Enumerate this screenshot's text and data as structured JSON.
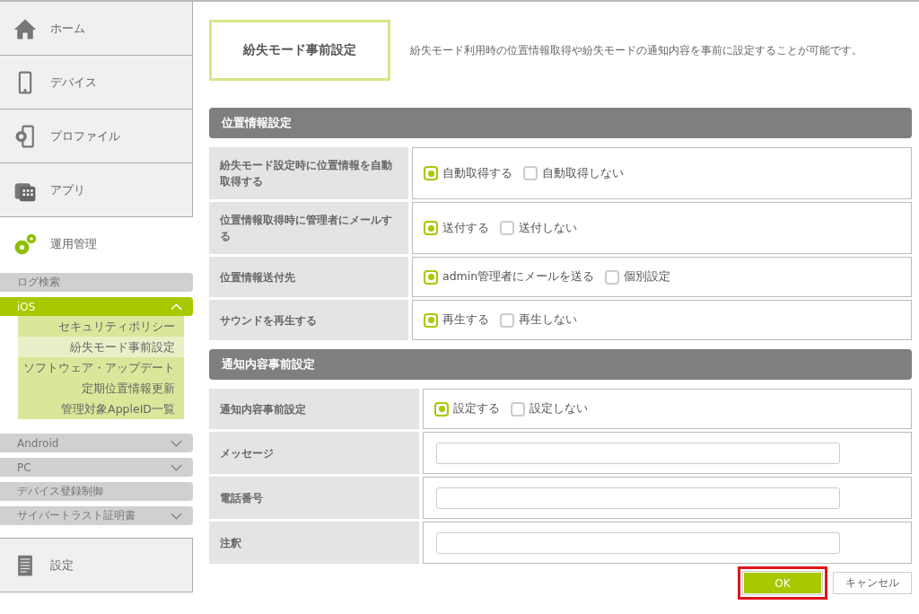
{
  "sidebar": {
    "items": [
      {
        "label": "ホーム",
        "selected": false
      },
      {
        "label": "デバイス",
        "selected": false
      },
      {
        "label": "プロファイル",
        "selected": false
      },
      {
        "label": "アプリ",
        "selected": false
      },
      {
        "label": "運用管理",
        "selected": true
      }
    ],
    "submenu": [
      {
        "kind": "link",
        "label": "ログ検索"
      },
      {
        "kind": "group",
        "label": "iOS",
        "expanded": true,
        "children": [
          {
            "label": "セキュリティポリシー",
            "selected": false
          },
          {
            "label": "紛失モード事前設定",
            "selected": true
          },
          {
            "label": "ソフトウェア・アップデート",
            "selected": false
          },
          {
            "label": "定期位置情報更新",
            "selected": false
          },
          {
            "label": "管理対象AppleID一覧",
            "selected": false
          }
        ]
      },
      {
        "kind": "group",
        "label": "Android",
        "expanded": false
      },
      {
        "kind": "group",
        "label": "PC",
        "expanded": false
      },
      {
        "kind": "link",
        "label": "デバイス登録制御"
      },
      {
        "kind": "group",
        "label": "サイバートラスト証明書",
        "expanded": false
      }
    ],
    "bottom_items": [
      {
        "label": "設定",
        "selected": false
      }
    ]
  },
  "page": {
    "title": "紛失モード事前設定",
    "description": "紛失モード利用時の位置情報取得や紛失モードの通知内容を事前に設定することが可能です。"
  },
  "sections": [
    {
      "title": "位置情報設定",
      "rows": [
        {
          "kind": "radio",
          "label": "紛失モード設定時に位置情報を自動取得する",
          "options": [
            {
              "label": "自動取得する",
              "selected": true
            },
            {
              "label": "自動取得しない",
              "selected": false
            }
          ]
        },
        {
          "kind": "radio",
          "label": "位置情報取得時に管理者にメールする",
          "options": [
            {
              "label": "送付する",
              "selected": true
            },
            {
              "label": "送付しない",
              "selected": false
            }
          ]
        },
        {
          "kind": "radio",
          "label": "位置情報送付先",
          "options": [
            {
              "label": "admin管理者にメールを送る",
              "selected": true
            },
            {
              "label": "個別設定",
              "selected": false
            }
          ]
        },
        {
          "kind": "radio",
          "label": "サウンドを再生する",
          "options": [
            {
              "label": "再生する",
              "selected": true
            },
            {
              "label": "再生しない",
              "selected": false
            }
          ]
        }
      ]
    },
    {
      "title": "通知内容事前設定",
      "rows": [
        {
          "kind": "radio",
          "label": "通知内容事前設定",
          "options": [
            {
              "label": "設定する",
              "selected": true
            },
            {
              "label": "設定しない",
              "selected": false
            }
          ]
        },
        {
          "kind": "text",
          "label": "メッセージ"
        },
        {
          "kind": "text",
          "label": "電話番号"
        },
        {
          "kind": "text",
          "label": "注釈"
        }
      ]
    }
  ],
  "buttons": [
    {
      "kind": "primary",
      "label": "OK",
      "highlighted": true
    },
    {
      "kind": "secondary",
      "label": "キャンセル",
      "highlighted": false
    }
  ]
}
